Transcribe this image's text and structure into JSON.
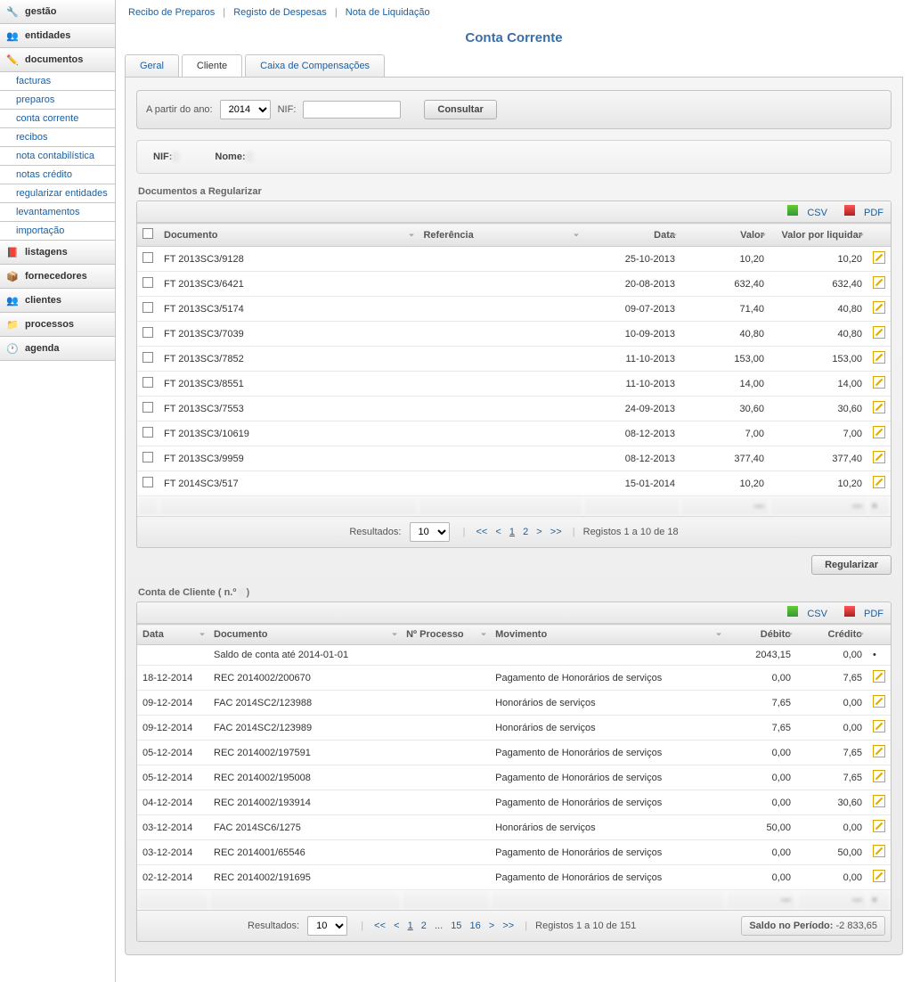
{
  "sidebar": {
    "items": [
      {
        "label": "gestão"
      },
      {
        "label": "entidades"
      },
      {
        "label": "documentos"
      },
      {
        "label": "listagens"
      },
      {
        "label": "fornecedores"
      },
      {
        "label": "clientes"
      },
      {
        "label": "processos"
      },
      {
        "label": "agenda"
      }
    ],
    "doc_sub": [
      "facturas",
      "preparos",
      "conta corrente",
      "recibos",
      "nota contabilística",
      "notas crédito",
      "regularizar entidades",
      "levantamentos",
      "importação"
    ]
  },
  "toplinks": {
    "r1": "Recibo de Preparos",
    "r2": "Registo de Despesas",
    "r3": "Nota de Liquidação"
  },
  "title": "Conta Corrente",
  "tabs": {
    "t1": "Geral",
    "t2": "Cliente",
    "t3": "Caixa de Compensações"
  },
  "filter": {
    "l1": "A partir do ano:",
    "year": "2014",
    "l2": "NIF:",
    "nif": "",
    "btn": "Consultar"
  },
  "info": {
    "nif_l": "NIF:",
    "nif_v": "        ",
    "nome_l": "Nome:",
    "nome_v": "                         "
  },
  "sec1": {
    "title": "Documentos a Regularizar"
  },
  "export": {
    "csv": "CSV",
    "pdf": "PDF"
  },
  "th1": {
    "doc": "Documento",
    "ref": "Referência",
    "data": "Data",
    "valor": "Valor",
    "vpl": "Valor por liquidar"
  },
  "rows1": [
    {
      "doc": "FT 2013SC3/9128",
      "ref": "",
      "data": "25-10-2013",
      "valor": "10,20",
      "vpl": "10,20"
    },
    {
      "doc": "FT 2013SC3/6421",
      "ref": "",
      "data": "20-08-2013",
      "valor": "632,40",
      "vpl": "632,40"
    },
    {
      "doc": "FT 2013SC3/5174",
      "ref": "",
      "data": "09-07-2013",
      "valor": "71,40",
      "vpl": "40,80"
    },
    {
      "doc": "FT 2013SC3/7039",
      "ref": "",
      "data": "10-09-2013",
      "valor": "40,80",
      "vpl": "40,80"
    },
    {
      "doc": "FT 2013SC3/7852",
      "ref": "",
      "data": "11-10-2013",
      "valor": "153,00",
      "vpl": "153,00"
    },
    {
      "doc": "FT 2013SC3/8551",
      "ref": "",
      "data": "11-10-2013",
      "valor": "14,00",
      "vpl": "14,00"
    },
    {
      "doc": "FT 2013SC3/7553",
      "ref": "",
      "data": "24-09-2013",
      "valor": "30,60",
      "vpl": "30,60"
    },
    {
      "doc": "FT 2013SC3/10619",
      "ref": "",
      "data": "08-12-2013",
      "valor": "7,00",
      "vpl": "7,00"
    },
    {
      "doc": "FT 2013SC3/9959",
      "ref": "",
      "data": "08-12-2013",
      "valor": "377,40",
      "vpl": "377,40"
    },
    {
      "doc": "FT 2014SC3/517",
      "ref": "",
      "data": "15-01-2014",
      "valor": "10,20",
      "vpl": "10,20"
    }
  ],
  "pager1": {
    "res": "Resultados:",
    "size": "10",
    "info": "Registos 1 a 10 de 18"
  },
  "regbtn": "Regularizar",
  "sec2": {
    "title": "Conta de Cliente",
    "par_l": "( n.º ",
    "par_r": " )",
    "acc": "        "
  },
  "th2": {
    "data": "Data",
    "doc": "Documento",
    "proc": "Nº Processo",
    "mov": "Movimento",
    "deb": "Débito",
    "cred": "Crédito"
  },
  "rows2": [
    {
      "data": "",
      "doc": "Saldo de conta até 2014-01-01",
      "proc": "",
      "mov": "",
      "deb": "2043,15",
      "cred": "0,00",
      "dot": true
    },
    {
      "data": "18-12-2014",
      "doc": "REC 2014002/200670",
      "proc": "",
      "mov": "Pagamento de Honorários de serviços",
      "deb": "0,00",
      "cred": "7,65"
    },
    {
      "data": "09-12-2014",
      "doc": "FAC 2014SC2/123988",
      "proc": "",
      "mov": "Honorários de serviços",
      "deb": "7,65",
      "cred": "0,00"
    },
    {
      "data": "09-12-2014",
      "doc": "FAC 2014SC2/123989",
      "proc": "",
      "mov": "Honorários de serviços",
      "deb": "7,65",
      "cred": "0,00"
    },
    {
      "data": "05-12-2014",
      "doc": "REC 2014002/197591",
      "proc": "",
      "mov": "Pagamento de Honorários de serviços",
      "deb": "0,00",
      "cred": "7,65"
    },
    {
      "data": "05-12-2014",
      "doc": "REC 2014002/195008",
      "proc": "",
      "mov": "Pagamento de Honorários de serviços",
      "deb": "0,00",
      "cred": "7,65"
    },
    {
      "data": "04-12-2014",
      "doc": "REC 2014002/193914",
      "proc": "",
      "mov": "Pagamento de Honorários de serviços",
      "deb": "0,00",
      "cred": "30,60"
    },
    {
      "data": "03-12-2014",
      "doc": "FAC 2014SC6/1275",
      "proc": "",
      "mov": "Honorários de serviços",
      "deb": "50,00",
      "cred": "0,00"
    },
    {
      "data": "03-12-2014",
      "doc": "REC 2014001/65546",
      "proc": "",
      "mov": "Pagamento de Honorários de serviços",
      "deb": "0,00",
      "cred": "50,00"
    },
    {
      "data": "02-12-2014",
      "doc": "REC 2014002/191695",
      "proc": "",
      "mov": "Pagamento de Honorários de serviços",
      "deb": "0,00",
      "cred": "0,00"
    }
  ],
  "pager2": {
    "res": "Resultados:",
    "size": "10",
    "info": "Registos 1 a 10 de 151",
    "pages": [
      "1",
      "2",
      "...",
      "15",
      "16"
    ]
  },
  "saldo": {
    "l": "Saldo no Período:",
    "v": "-2 833,65"
  }
}
